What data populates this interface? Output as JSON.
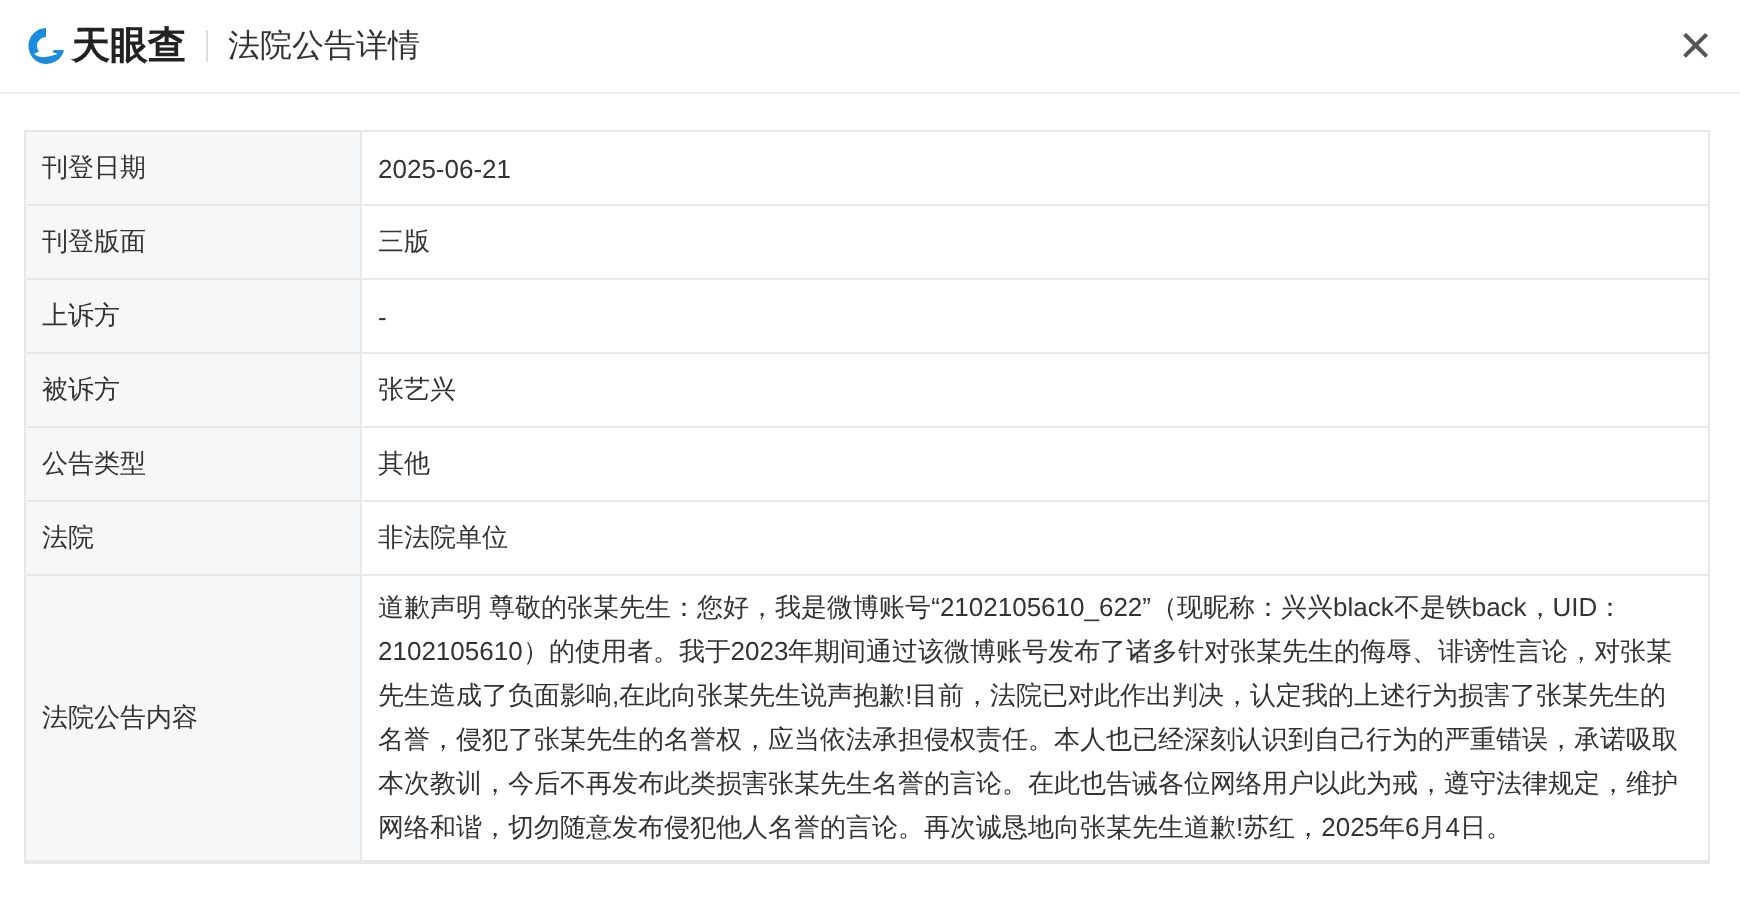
{
  "header": {
    "logo": "天眼查",
    "title": "法院公告详情",
    "close": "×"
  },
  "rows": [
    {
      "label": "刊登日期",
      "value": "2025-06-21"
    },
    {
      "label": "刊登版面",
      "value": "三版"
    },
    {
      "label": "上诉方",
      "value": "-"
    },
    {
      "label": "被诉方",
      "value": "张艺兴"
    },
    {
      "label": "公告类型",
      "value": "其他"
    },
    {
      "label": "法院",
      "value": "非法院单位"
    },
    {
      "label": "法院公告内容",
      "value": "道歉声明 尊敬的张某先生：您好，我是微博账号“2102105610_622”（现昵称：兴兴black不是铁back，UID：2102105610）的使用者。我于2023年期间通过该微博账号发布了诸多针对张某先生的侮辱、诽谤性言论，对张某先生造成了负面影响,在此向张某先生说声抱歉!目前，法院已对此作出判决，认定我的上述行为损害了张某先生的名誉，侵犯了张某先生的名誉权，应当依法承担侵权责任。本人也已经深刻认识到自己行为的严重错误，承诺吸取本次教训，今后不再发布此类损害张某先生名誉的言论。在此也告诫各位网络用户以此为戒，遵守法律规定，维护网络和谐，切勿随意发布侵犯他人名誉的言论。再次诚恳地向张某先生道歉!苏红，2025年6月4日。"
    }
  ]
}
